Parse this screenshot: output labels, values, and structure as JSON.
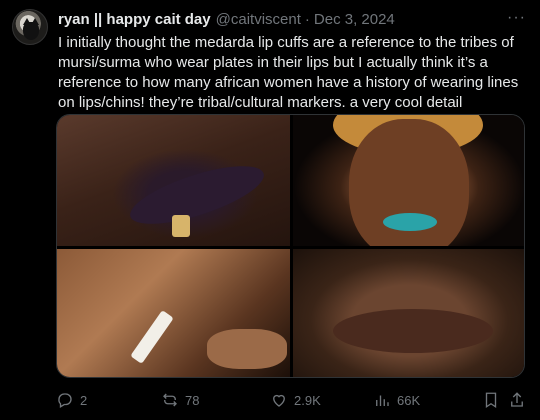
{
  "post": {
    "display_name": "ryan || happy cait day",
    "handle": "@caitviscent",
    "separator": "·",
    "date": "Dec 3, 2024",
    "more_label": "···",
    "text": "I initially thought the medarda lip cuffs are a reference to the tribes of mursi/surma who wear plates in their lips but I actually think it’s a reference to how many african women have a history of wearing lines on lips/chins! they’re tribal/cultural markers. a very cool detail"
  },
  "media": {
    "count": 4,
    "images": [
      {
        "subject": "dark lips with gold lip cuff"
      },
      {
        "subject": "woman with face paint and teal lips"
      },
      {
        "subject": "lips with white line and nose ring"
      },
      {
        "subject": "close-up of brown lips"
      }
    ]
  },
  "actions": {
    "replies": "2",
    "reposts": "78",
    "likes": "2.9K",
    "views": "66K"
  },
  "icons": {
    "reply": "reply-icon",
    "repost": "repost-icon",
    "like": "heart-icon",
    "views": "views-icon",
    "bookmark": "bookmark-icon",
    "share": "share-icon"
  },
  "colors": {
    "background": "#000000",
    "text": "#e7e9ea",
    "muted": "#71767b"
  }
}
